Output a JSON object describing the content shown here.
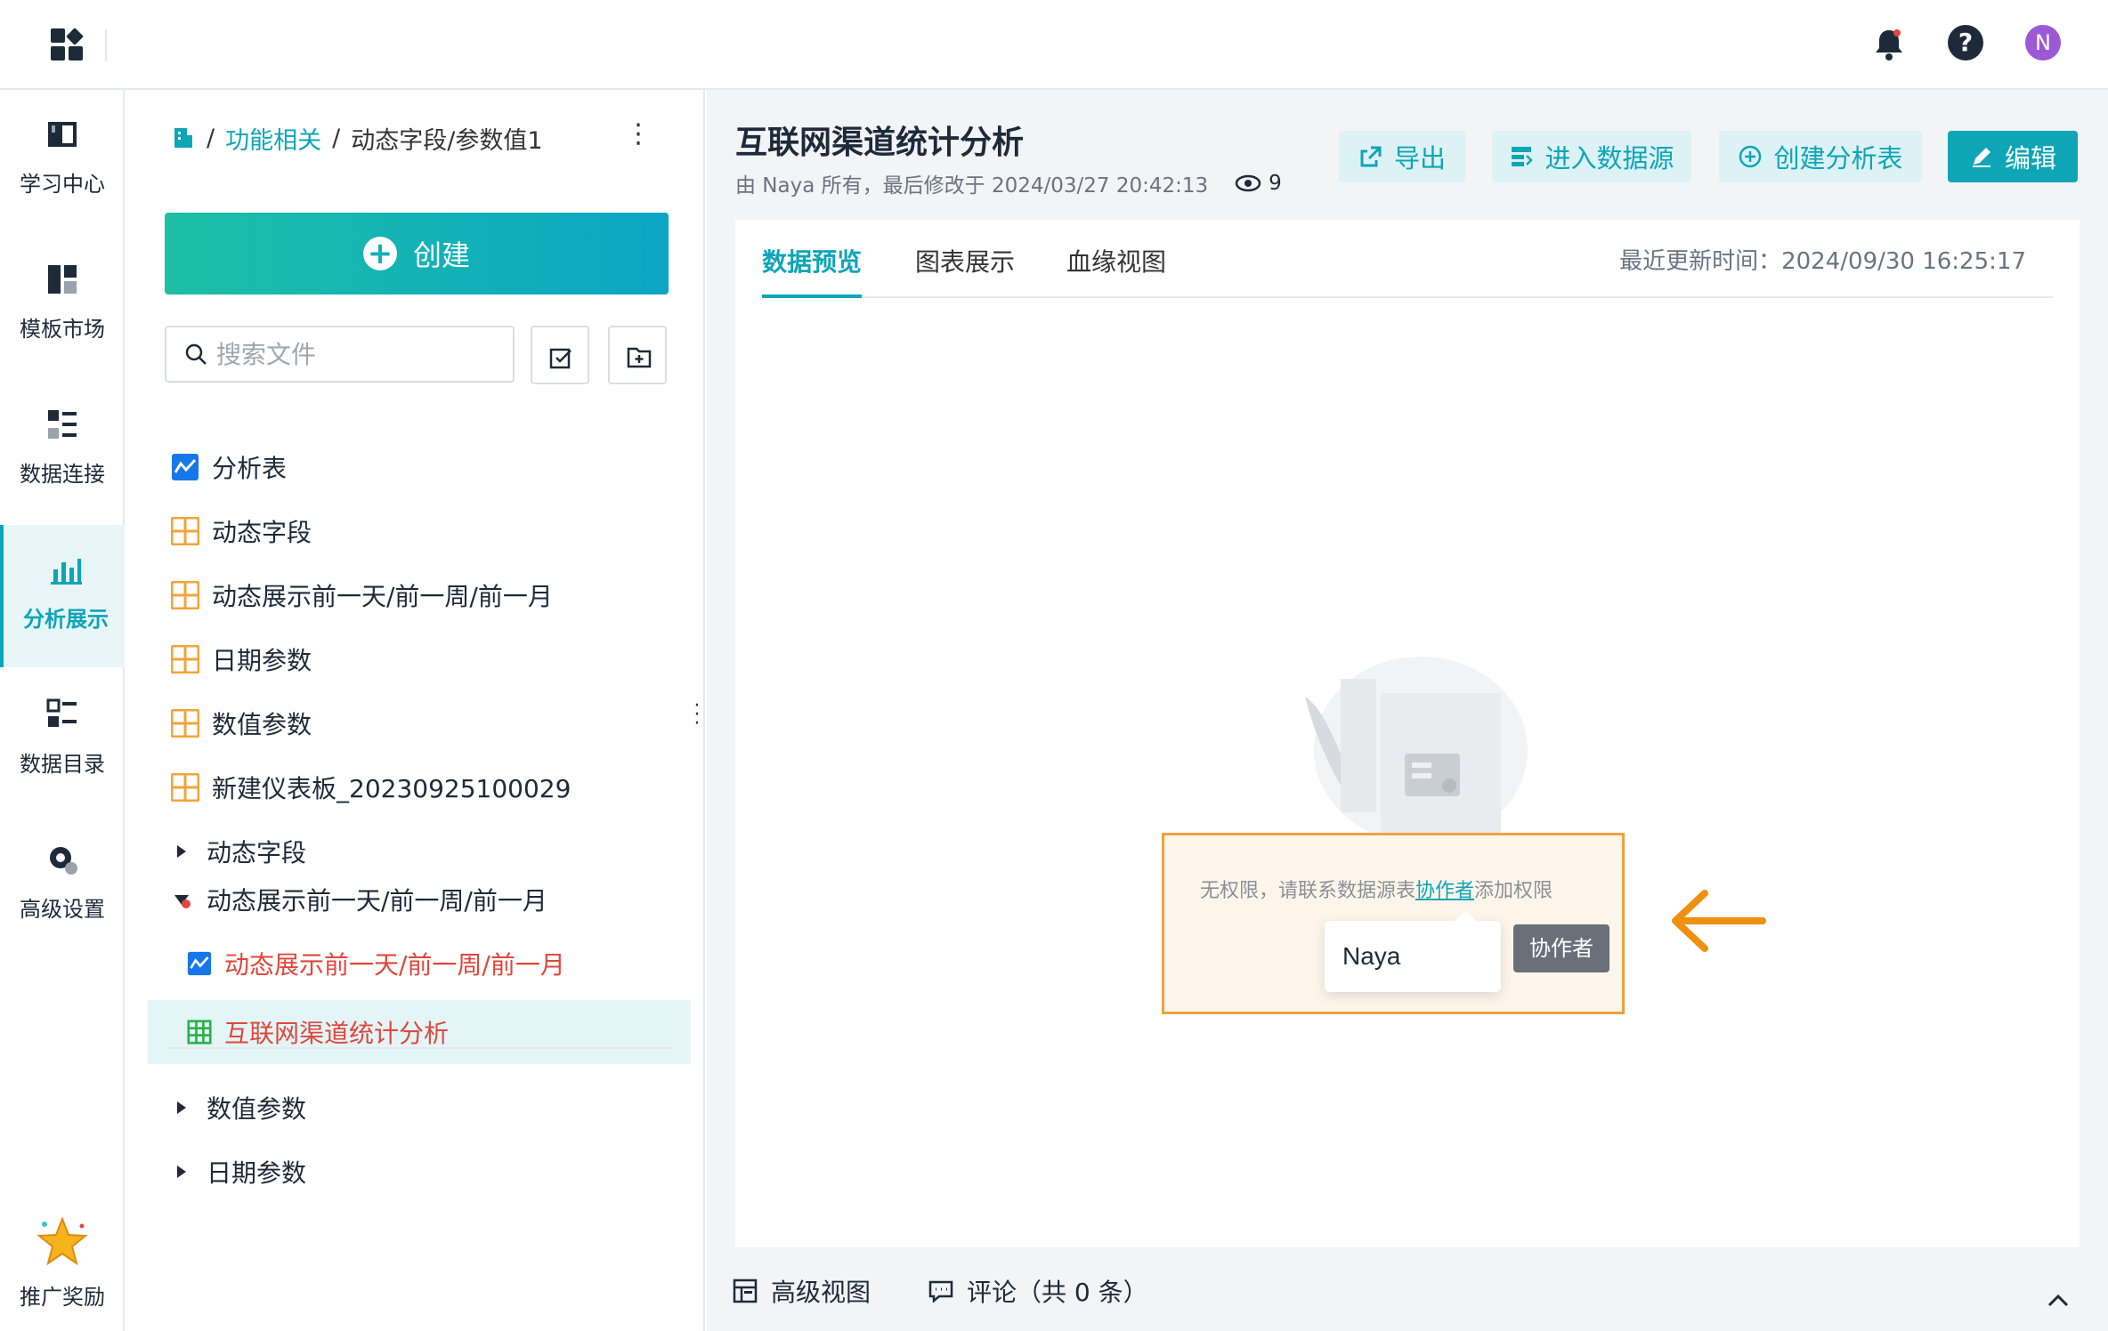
{
  "topbar": {
    "app_menu_icon": "apps-grid-icon",
    "notification_icon": "bell-icon",
    "help_label": "?",
    "avatar_initial": "N"
  },
  "leftnav": {
    "items": [
      {
        "label": "学习中心",
        "icon": "book-icon",
        "active": false
      },
      {
        "label": "模板市场",
        "icon": "template-icon",
        "active": false
      },
      {
        "label": "数据连接",
        "icon": "data-connect-icon",
        "active": false
      },
      {
        "label": "分析展示",
        "icon": "chart-icon",
        "active": true
      },
      {
        "label": "数据目录",
        "icon": "catalog-icon",
        "active": false
      },
      {
        "label": "高级设置",
        "icon": "gear-icon",
        "active": false
      }
    ],
    "promo": {
      "label": "推广奖励",
      "icon": "star-icon"
    }
  },
  "tree_panel": {
    "breadcrumb": {
      "sep": "/",
      "link": "功能相关",
      "current": "动态字段/参数值1"
    },
    "more_label": "⋮",
    "create_label": "创建",
    "search_placeholder": "搜索文件",
    "items": [
      {
        "label": "分析表",
        "icon": "analysis-icon",
        "type": "file"
      },
      {
        "label": "动态字段",
        "icon": "dashboard-icon",
        "type": "file"
      },
      {
        "label": "动态展示前一天/前一周/前一月",
        "icon": "dashboard-icon",
        "type": "file"
      },
      {
        "label": "日期参数",
        "icon": "dashboard-icon",
        "type": "file"
      },
      {
        "label": "数值参数",
        "icon": "dashboard-icon",
        "type": "file"
      },
      {
        "label": "新建仪表板_20230925100029",
        "icon": "dashboard-icon",
        "type": "file"
      },
      {
        "label": "动态字段",
        "type": "folder",
        "expanded": false
      },
      {
        "label": "动态展示前一天/前一周/前一月",
        "type": "folder",
        "expanded": true
      },
      {
        "label": "动态展示前一天/前一周/前一月",
        "icon": "analysis-icon",
        "type": "child",
        "red": true
      },
      {
        "label": "互联网渠道统计分析",
        "icon": "table-icon",
        "type": "child",
        "red": true,
        "selected": true
      },
      {
        "label": "数值参数",
        "type": "folder",
        "expanded": false
      },
      {
        "label": "日期参数",
        "type": "folder",
        "expanded": false
      }
    ]
  },
  "main": {
    "title": "互联网渠道统计分析",
    "meta": "由 Naya 所有，最后修改于 2024/03/27 20:42:13",
    "views_count": "9",
    "actions": {
      "export": "导出",
      "enter_datasource": "进入数据源",
      "create_analysis": "创建分析表",
      "edit": "编辑"
    },
    "tabs": [
      "数据预览",
      "图表展示",
      "血缘视图"
    ],
    "active_tab": 0,
    "updated": "最近更新时间：2024/09/30 16:25:17",
    "permission": {
      "text_before": "无权限，请联系数据源表",
      "link": "协作者",
      "text_after": "添加权限",
      "popover_name": "Naya",
      "tooltip": "协作者"
    },
    "bottom": {
      "advanced_view": "高级视图",
      "comments": "评论（共 0 条）"
    }
  },
  "colors": {
    "accent": "#0ea5b7",
    "highlight_border": "#f0a23c",
    "red_text": "#e0473c",
    "dashboard_orange": "#f5a33b"
  }
}
